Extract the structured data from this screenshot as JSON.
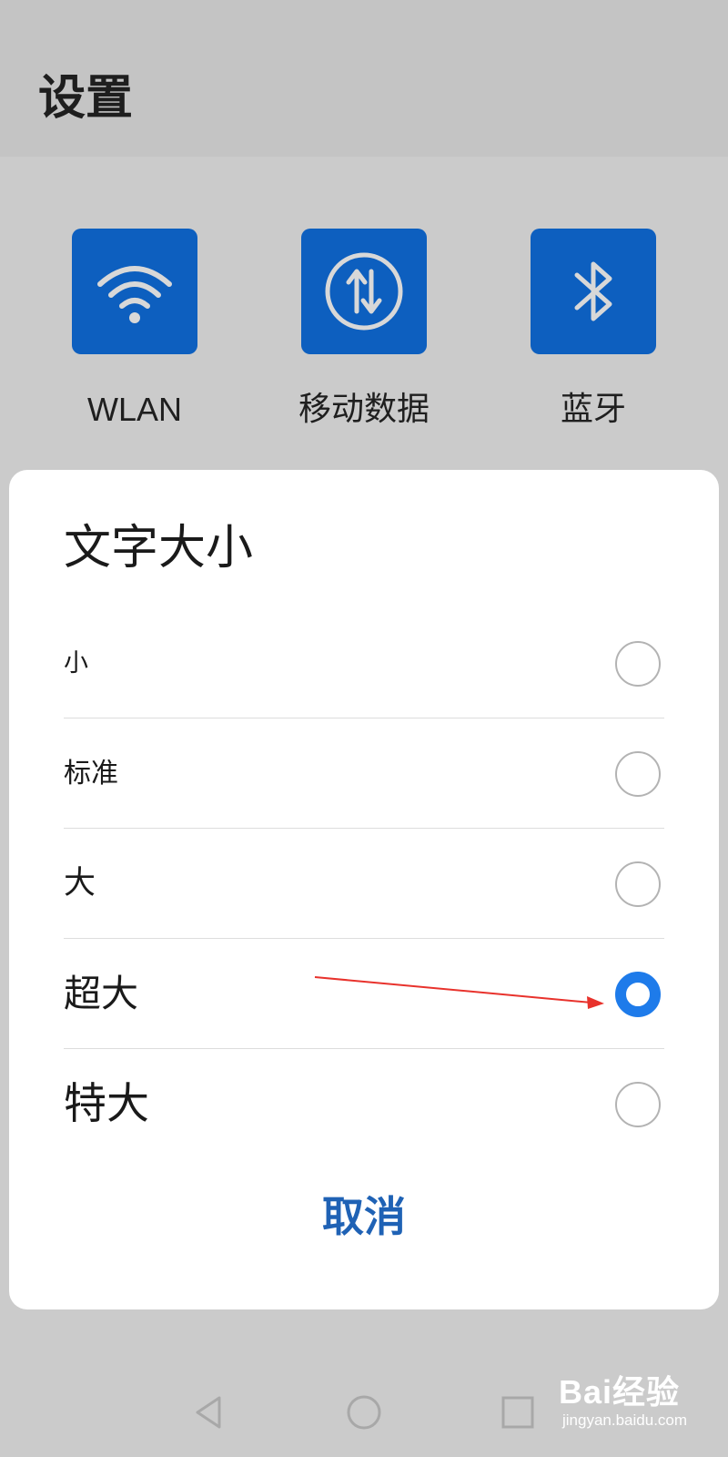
{
  "header": {
    "title": "设置"
  },
  "tiles": [
    {
      "label": "WLAN",
      "icon": "wifi-icon"
    },
    {
      "label": "移动数据",
      "icon": "mobile-data-icon"
    },
    {
      "label": "蓝牙",
      "icon": "bluetooth-icon"
    }
  ],
  "dialog": {
    "title": "文字大小",
    "options": [
      {
        "label": "小",
        "selected": false
      },
      {
        "label": "标准",
        "selected": false
      },
      {
        "label": "大",
        "selected": false
      },
      {
        "label": "超大",
        "selected": true
      },
      {
        "label": "特大",
        "selected": false
      }
    ],
    "cancel_label": "取消"
  },
  "navbar": {
    "back_icon": "back-triangle-icon",
    "home_icon": "home-circle-icon",
    "recent_icon": "recent-square-icon"
  },
  "watermark": {
    "logo": "Bai经验",
    "url": "jingyan.baidu.com"
  },
  "colors": {
    "tile_blue": "#0d5fbf",
    "radio_selected": "#1e7bea",
    "cancel_text": "#1f62b5",
    "arrow": "#e8322c"
  }
}
